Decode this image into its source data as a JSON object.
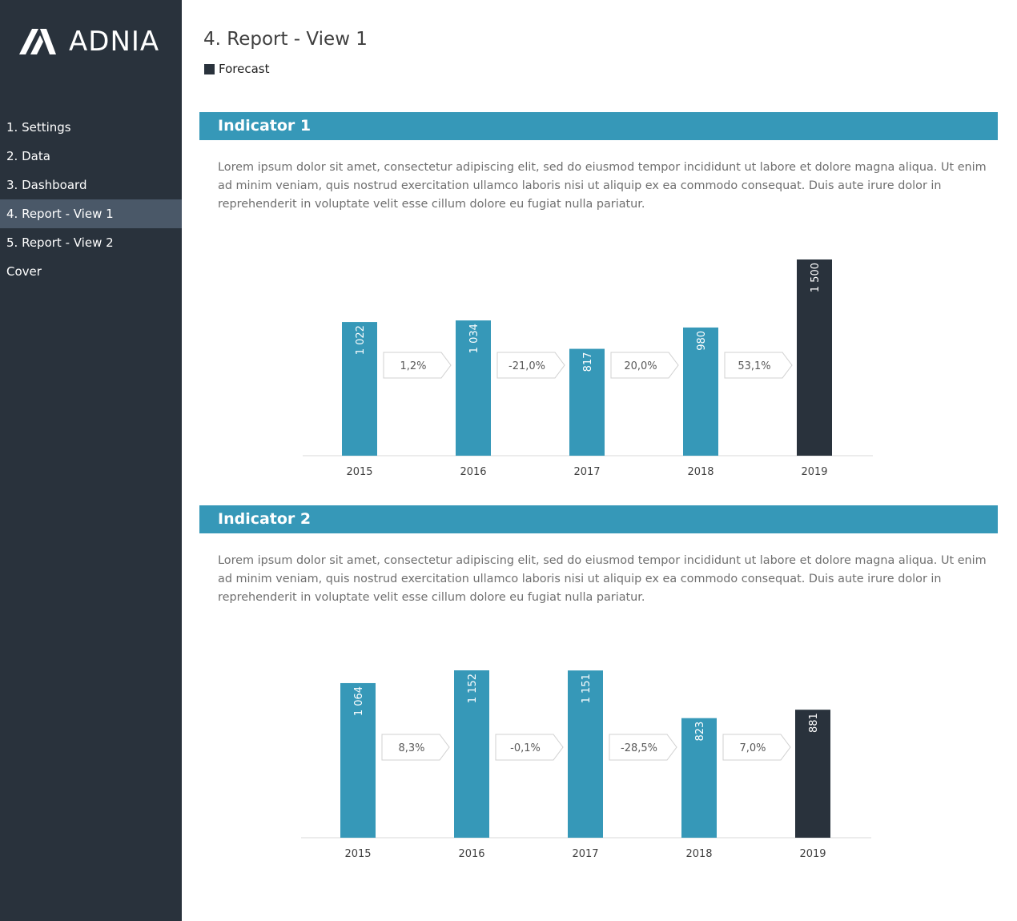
{
  "logo": {
    "text": "ADNIA"
  },
  "sidebar": {
    "items": [
      {
        "label": "1. Settings",
        "active": false
      },
      {
        "label": "2. Data",
        "active": false
      },
      {
        "label": "3. Dashboard",
        "active": false
      },
      {
        "label": "4. Report - View 1",
        "active": true
      },
      {
        "label": "5. Report - View 2",
        "active": false
      },
      {
        "label": "Cover",
        "active": false
      }
    ]
  },
  "header": {
    "title": "4. Report - View 1"
  },
  "legend": {
    "label": "Forecast"
  },
  "colors": {
    "actual": "#3698b8",
    "forecast": "#29323c",
    "sidebar": "#29323c",
    "sidebar_active": "#4a5868"
  },
  "sections": [
    {
      "title": "Indicator 1",
      "text": "Lorem ipsum dolor sit amet, consectetur adipiscing elit, sed do eiusmod tempor incididunt ut labore et dolore magna aliqua. Ut enim ad minim veniam, quis nostrud exercitation ullamco laboris nisi ut aliquip ex ea commodo consequat. Duis aute irure dolor in reprehenderit in voluptate velit esse cillum dolore eu fugiat nulla pariatur."
    },
    {
      "title": "Indicator 2",
      "text": "Lorem ipsum dolor sit amet, consectetur adipiscing elit, sed do eiusmod tempor incididunt ut labore et dolore magna aliqua. Ut enim ad minim veniam, quis nostrud exercitation ullamco laboris nisi ut aliquip ex ea commodo consequat. Duis aute irure dolor in reprehenderit in voluptate velit esse cillum dolore eu fugiat nulla pariatur."
    }
  ],
  "chart_data": [
    {
      "type": "bar",
      "categories": [
        "2015",
        "2016",
        "2017",
        "2018",
        "2019"
      ],
      "values": [
        1022,
        1034,
        817,
        980,
        1500
      ],
      "value_labels": [
        "1 022",
        "1 034",
        "817",
        "980",
        "1 500"
      ],
      "forecast": [
        false,
        false,
        false,
        false,
        true
      ],
      "changes": [
        "1,2%",
        "-21,0%",
        "20,0%",
        "53,1%"
      ],
      "ylim": [
        0,
        1500
      ]
    },
    {
      "type": "bar",
      "categories": [
        "2015",
        "2016",
        "2017",
        "2018",
        "2019"
      ],
      "values": [
        1064,
        1152,
        1151,
        823,
        881
      ],
      "value_labels": [
        "1 064",
        "1 152",
        "1 151",
        "823",
        "881"
      ],
      "forecast": [
        false,
        false,
        false,
        false,
        true
      ],
      "changes": [
        "8,3%",
        "-0,1%",
        "-28,5%",
        "7,0%"
      ],
      "ylim": [
        0,
        1152
      ]
    }
  ]
}
